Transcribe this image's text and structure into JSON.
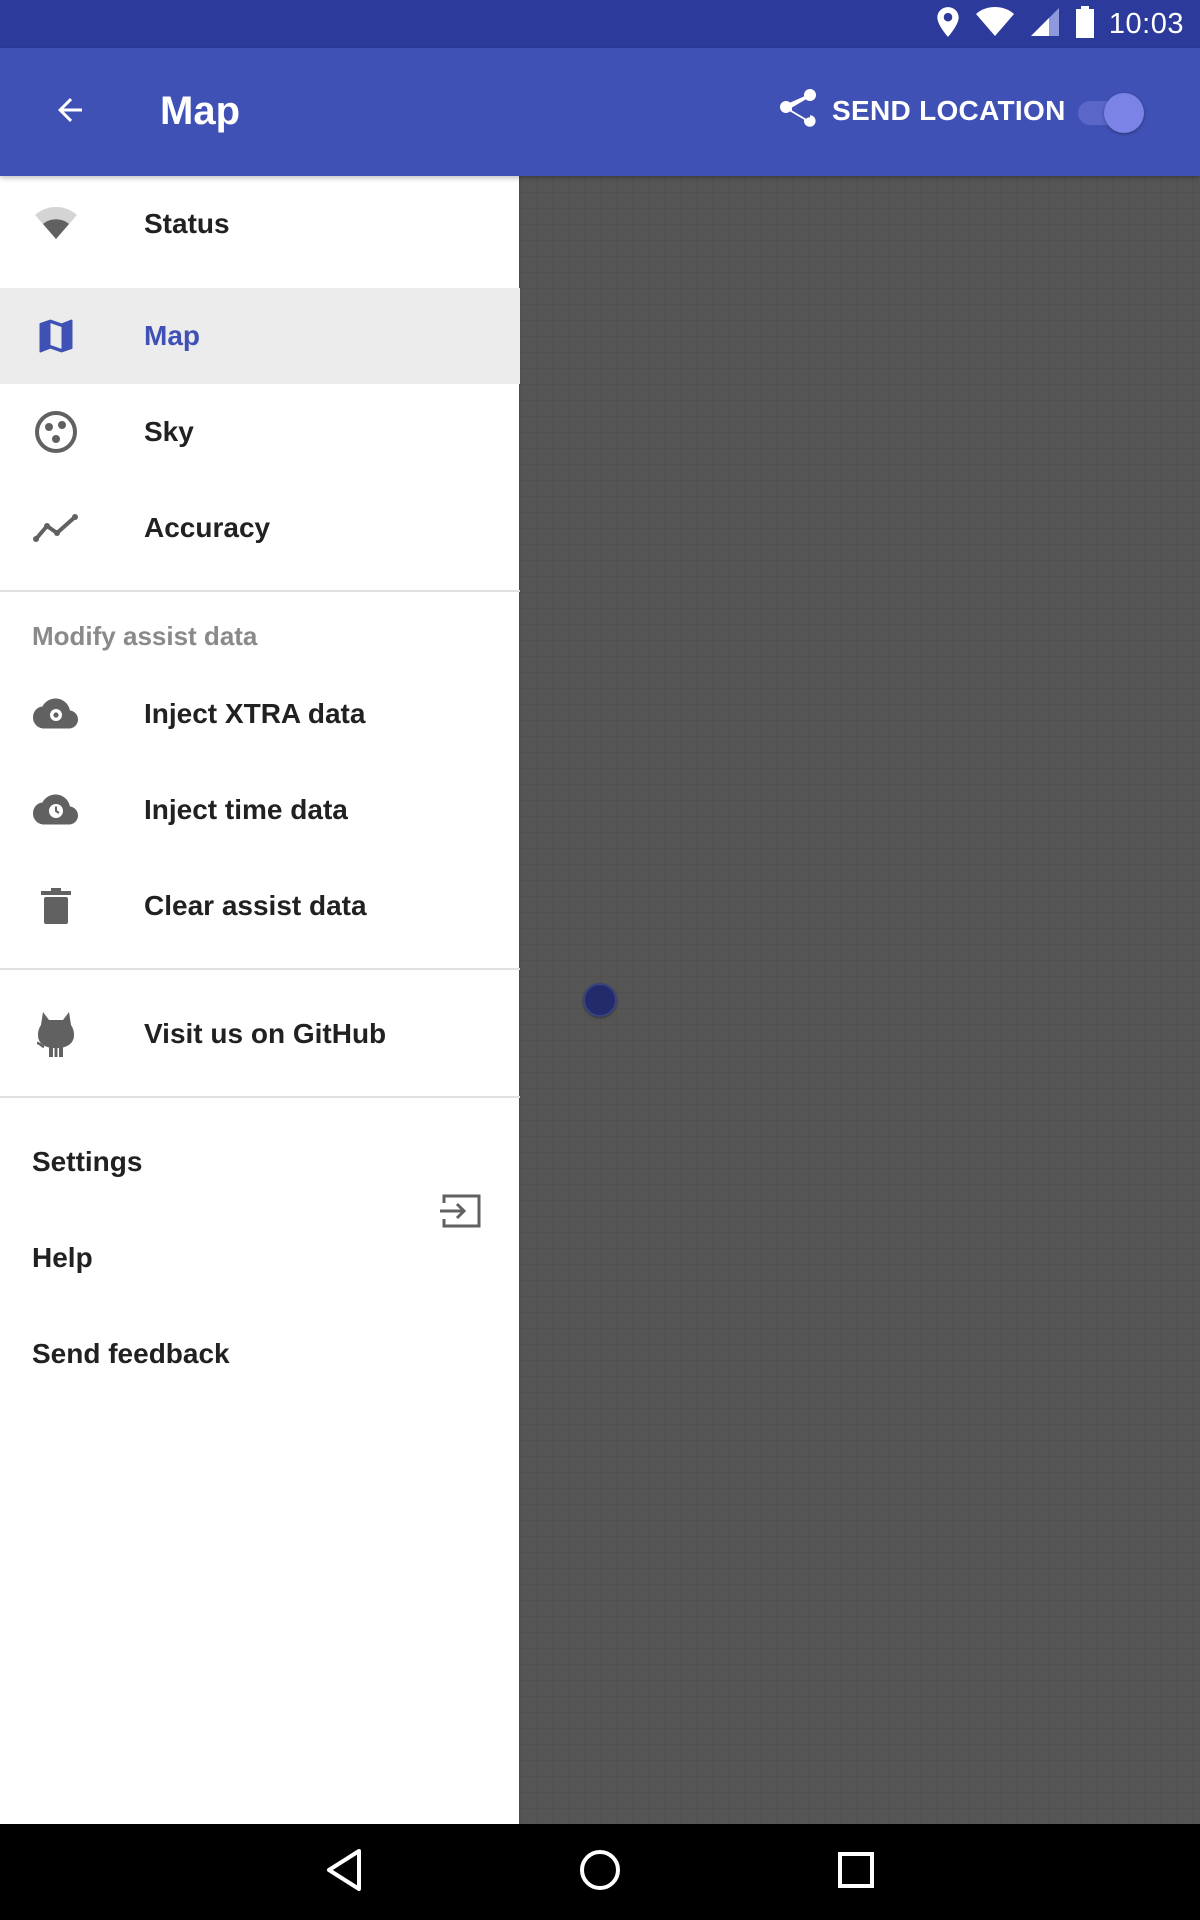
{
  "status_bar": {
    "time": "10:03",
    "icons": [
      "location-icon",
      "wifi-icon",
      "signal-icon",
      "battery-icon"
    ]
  },
  "app_bar": {
    "title": "Map",
    "back_icon": "arrow-back-icon",
    "send_location_label": "SEND LOCATION",
    "send_icon": "share-icon",
    "toggle_on": true
  },
  "drawer": {
    "primary_items": [
      {
        "label": "Status",
        "icon": "wifi-icon",
        "selected": false
      },
      {
        "label": "Map",
        "icon": "map-icon",
        "selected": true
      },
      {
        "label": "Sky",
        "icon": "satellite-icon",
        "selected": false
      },
      {
        "label": "Accuracy",
        "icon": "chart-line-icon",
        "selected": false
      }
    ],
    "assist_header": "Modify assist data",
    "assist_items": [
      {
        "label": "Inject XTRA data",
        "icon": "cloud-settings-icon"
      },
      {
        "label": "Inject time data",
        "icon": "cloud-clock-icon"
      },
      {
        "label": "Clear assist data",
        "icon": "trash-icon"
      }
    ],
    "github_item": {
      "label": "Visit us on GitHub",
      "icon": "github-icon",
      "trailing_icon": "open-external-icon"
    },
    "footer_items": [
      {
        "label": "Settings"
      },
      {
        "label": "Help"
      },
      {
        "label": "Send feedback"
      }
    ]
  },
  "colors": {
    "primary": "#3f51b5",
    "primary_dark": "#2c3a9b",
    "map_background": "#565555",
    "selected_row": "#ececec"
  },
  "system_nav": [
    "back-triangle-icon",
    "home-circle-icon",
    "recents-square-icon"
  ]
}
